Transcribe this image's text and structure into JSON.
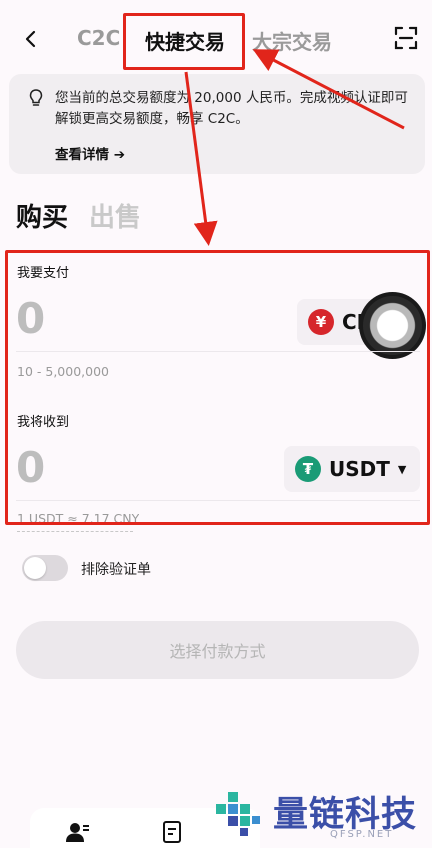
{
  "nav": {
    "tabs": [
      {
        "label": "C2C"
      },
      {
        "label": "快捷交易"
      },
      {
        "label": "大宗交易"
      }
    ]
  },
  "banner": {
    "text": "您当前的总交易额度为 20,000 人民币。完成视频认证即可解锁更高交易额度，畅享 C2C。",
    "link": "查看详情 ➔"
  },
  "side": {
    "buy": "购买",
    "sell": "出售"
  },
  "pay": {
    "label": "我要支付",
    "amount": "0",
    "currency_symbol": "¥",
    "currency": "CNY",
    "range": "10 - 5,000,000"
  },
  "receive": {
    "label": "我将收到",
    "amount": "0",
    "currency_symbol": "₮",
    "currency": "USDT",
    "rate": "1 USDT ≈ 7.17 CNY"
  },
  "toggle": {
    "label": "排除验证单"
  },
  "main_button": {
    "label": "选择付款方式"
  },
  "watermark": {
    "brand": "量链科技",
    "site": "QFSP.NET"
  },
  "colors": {
    "annotation_red": "#e1251b",
    "cny_red": "#d6262b",
    "usdt_green": "#1a9b76",
    "watermark_blue": "#3b4fa8"
  },
  "icons": [
    "back-icon",
    "scan-icon",
    "bulb-icon",
    "caret-down-icon",
    "user-icon",
    "order-icon"
  ]
}
